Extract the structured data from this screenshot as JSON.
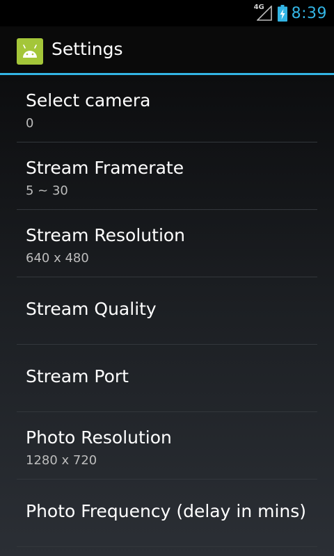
{
  "status_bar": {
    "network_type": "4G",
    "time": "8:39",
    "icons": [
      "signal-icon",
      "battery-charging-icon"
    ],
    "accent_color": "#33b5e5"
  },
  "action_bar": {
    "app_icon": "android-icon",
    "title": "Settings"
  },
  "preferences": [
    {
      "title": "Select camera",
      "summary": "0"
    },
    {
      "title": "Stream Framerate",
      "summary": "5 ~ 30"
    },
    {
      "title": "Stream Resolution",
      "summary": "640 x 480"
    },
    {
      "title": "Stream Quality",
      "summary": ""
    },
    {
      "title": "Stream Port",
      "summary": ""
    },
    {
      "title": "Photo Resolution",
      "summary": "1280 x 720"
    },
    {
      "title": "Photo Frequency (delay in mins)",
      "summary": ""
    }
  ]
}
